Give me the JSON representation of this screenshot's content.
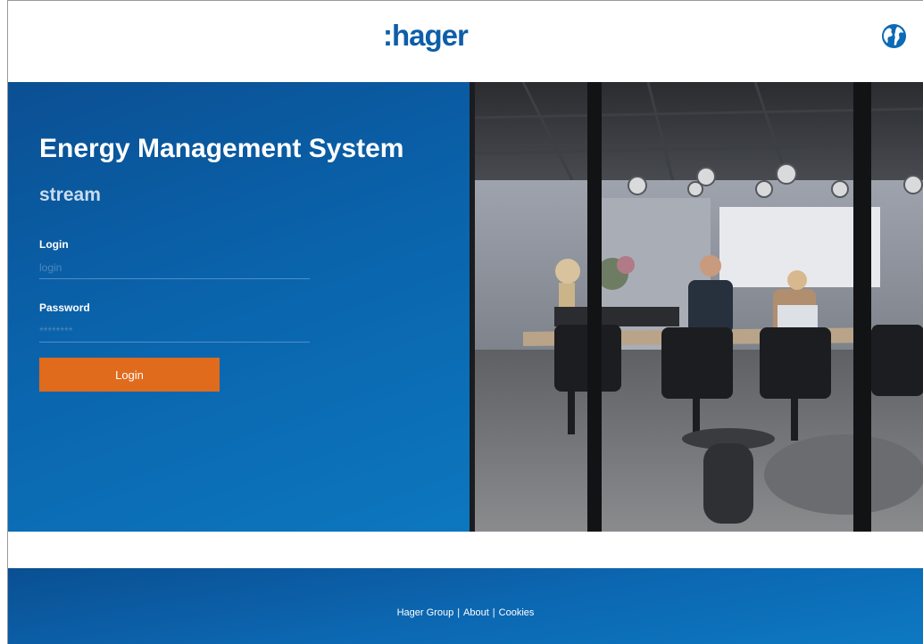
{
  "header": {
    "logo_colon": ":",
    "logo_text": "hager",
    "language_icon": "globe-icon"
  },
  "hero": {
    "title": "Energy Management System",
    "subtitle": "stream",
    "login_label": "Login",
    "login_placeholder": "login",
    "password_label": "Password",
    "password_placeholder": "********",
    "login_button": "Login",
    "image_icon": "meeting-room-photo"
  },
  "footer": {
    "links": [
      "Hager Group",
      "About",
      "Cookies"
    ],
    "separator": "|"
  },
  "colors": {
    "brand_blue": "#0d5ea9",
    "accent_orange": "#e06b1c"
  }
}
